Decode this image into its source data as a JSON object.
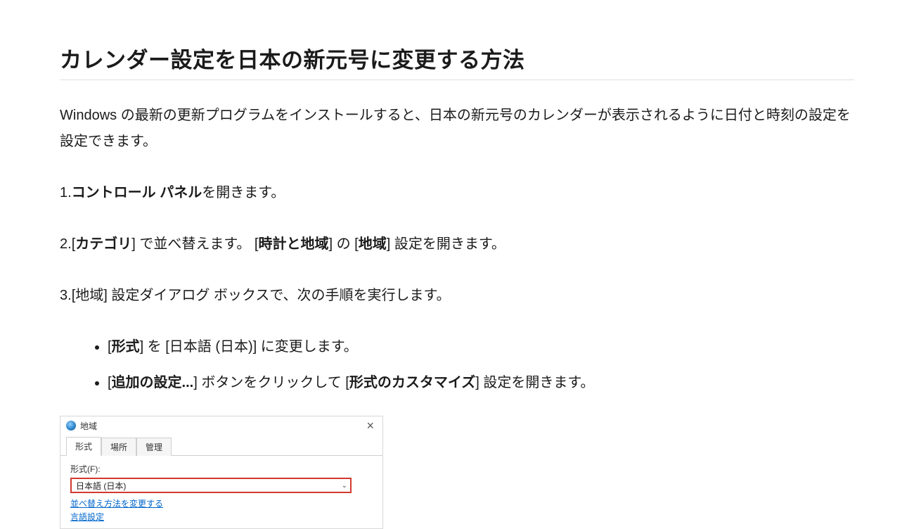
{
  "title": "カレンダー設定を日本の新元号に変更する方法",
  "intro": "Windows の最新の更新プログラムをインストールすると、日本の新元号のカレンダーが表示されるように日付と時刻の設定を設定できます。",
  "steps": {
    "s1": {
      "num": "1.",
      "bold1": "コントロール パネル",
      "tail": "を開きます。"
    },
    "s2": {
      "num": "2.",
      "t1": "[",
      "b1": "カテゴリ",
      "t2": "] で並べ替えます。 [",
      "b2": "時計と地域",
      "t3": "] の [",
      "b3": "地域",
      "t4": "] 設定を開きます。"
    },
    "s3": {
      "num": "3.",
      "text": "[地域] 設定ダイアログ ボックスで、次の手順を実行します。"
    }
  },
  "bullets": {
    "b1": {
      "t1": "[",
      "bold1": "形式",
      "t2": "] を [日本語 (日本)] に変更します。"
    },
    "b2": {
      "t1": "[",
      "bold1": "追加の設定...",
      "t2": "] ボタンをクリックして [",
      "bold2": "形式のカスタマイズ",
      "t3": "] 設定を開きます。"
    }
  },
  "dialog": {
    "title": "地域",
    "close": "×",
    "tabs": {
      "t1": "形式",
      "t2": "場所",
      "t3": "管理"
    },
    "format_label": "形式(F):",
    "format_value": "日本語 (日本)",
    "link1": "並べ替え方法を変更する",
    "link2": "言語設定"
  }
}
